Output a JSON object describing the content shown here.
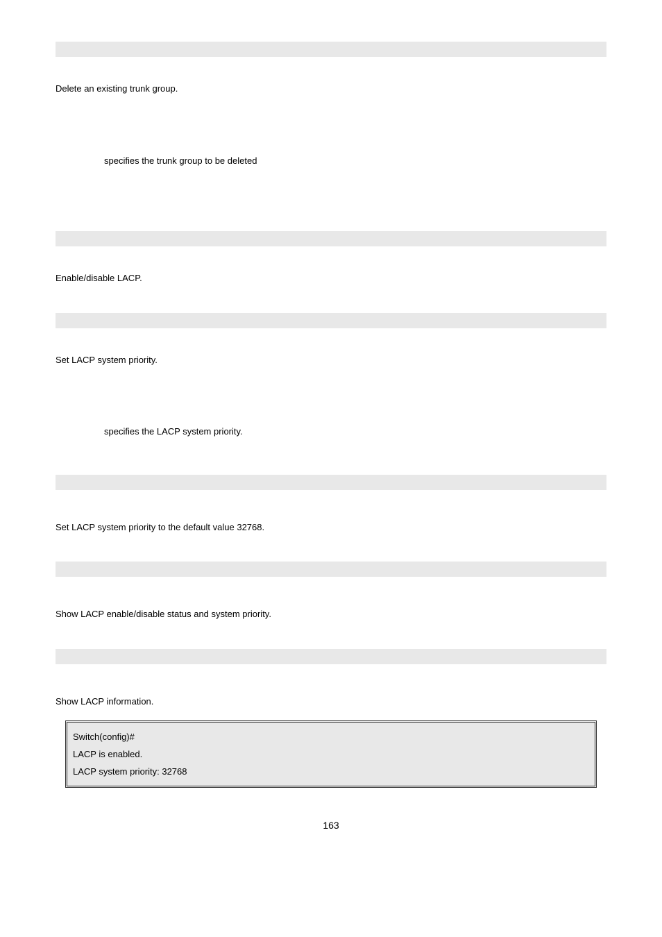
{
  "section1": {
    "text1": "Delete an existing trunk group.",
    "text2": "specifies the trunk group to be deleted"
  },
  "section2": {
    "text1": "Enable/disable LACP."
  },
  "section3": {
    "text1": "Set LACP system priority.",
    "text2": "specifies the LACP system priority."
  },
  "section4": {
    "text1": "Set LACP system priority to the default value 32768."
  },
  "section5": {
    "text1": "Show LACP enable/disable status and system priority."
  },
  "section6": {
    "text1": "Show LACP information.",
    "code_line1": "Switch(config)#",
    "code_line2": "LACP is enabled.",
    "code_line3": "LACP system priority: 32768"
  },
  "page_number": "163"
}
